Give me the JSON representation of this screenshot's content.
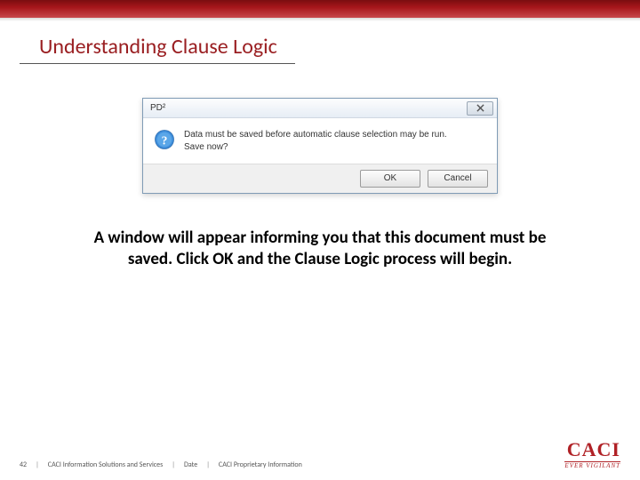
{
  "header": {
    "title": "Understanding Clause Logic"
  },
  "dialog": {
    "window_title": "PD²",
    "message_line1": "Data must be saved before automatic clause selection may be run.",
    "message_line2": "Save now?",
    "ok_label": "OK",
    "cancel_label": "Cancel"
  },
  "caption": "A window will appear informing you that this document must be saved.  Click OK and the Clause Logic process will begin.",
  "footer": {
    "page_number": "42",
    "org": "CACI Information Solutions and Services",
    "date_label": "Date",
    "proprietary": "CACI Proprietary Information",
    "logo_text": "CACI",
    "logo_tagline": "EVER VIGILANT"
  }
}
